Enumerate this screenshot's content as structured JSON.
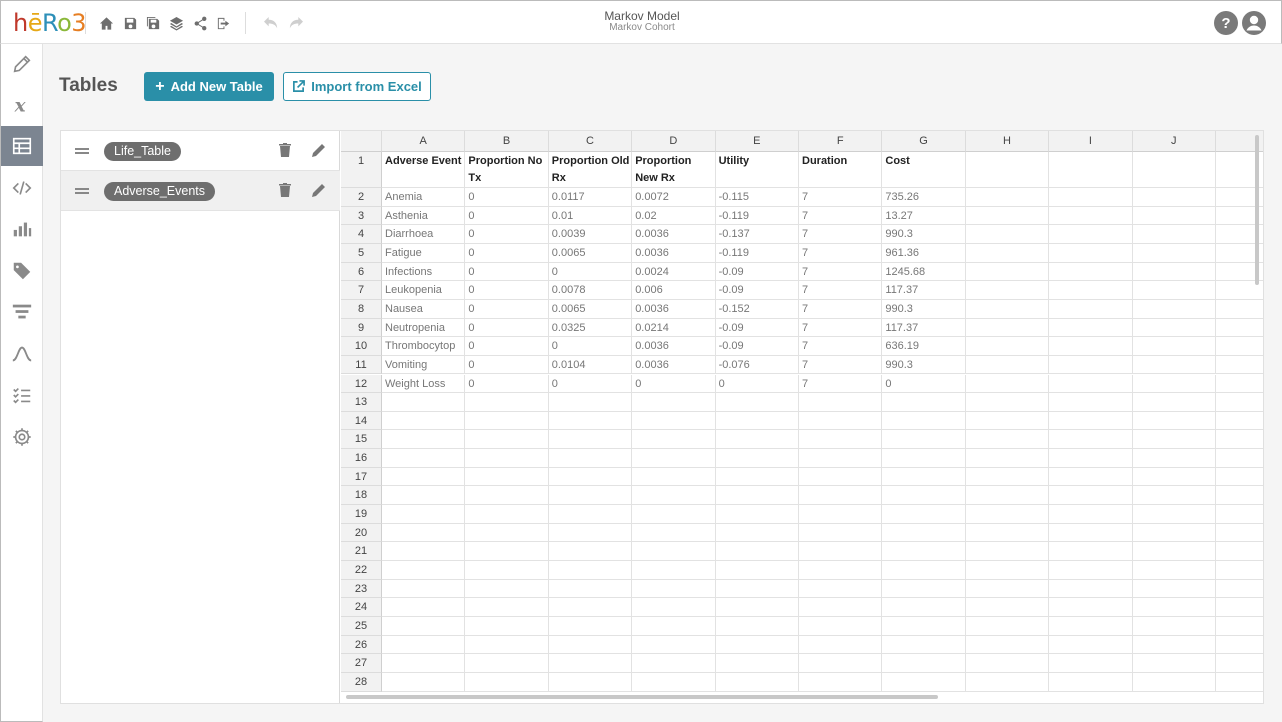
{
  "app": {
    "logo": [
      "h",
      "ē",
      "R",
      "o",
      "3"
    ],
    "title": "Markov Model",
    "subtitle": "Markov Cohort",
    "help_label": "?"
  },
  "toolbar": {
    "icons": [
      "home-icon",
      "save-icon",
      "save-as-icon",
      "layers-icon",
      "share-icon",
      "export-icon",
      "undo-icon",
      "redo-icon"
    ]
  },
  "sidebar": {
    "items": [
      "pencil-icon",
      "variable-x-icon",
      "table-icon",
      "code-icon",
      "bar-chart-icon",
      "tag-icon",
      "filter-icon",
      "curve-icon",
      "checklist-icon",
      "gear-icon"
    ],
    "active": "table-icon"
  },
  "page": {
    "title": "Tables",
    "add_label": "Add New Table",
    "import_label": "Import from Excel"
  },
  "tables": [
    {
      "name": "Life_Table",
      "selected": false
    },
    {
      "name": "Adverse_Events",
      "selected": true
    }
  ],
  "sheet": {
    "columns": [
      "A",
      "B",
      "C",
      "D",
      "E",
      "F",
      "G",
      "H",
      "I",
      "J",
      ""
    ],
    "header_row": [
      "Adverse Event",
      "Proportion No Tx",
      "Proportion Old Rx",
      "Proportion New Rx",
      "Utility",
      "Duration",
      "Cost"
    ],
    "rows": [
      [
        "Anemia",
        "0",
        "0.0117",
        "0.0072",
        "-0.115",
        "7",
        "735.26"
      ],
      [
        "Asthenia",
        "0",
        "0.01",
        "0.02",
        "-0.119",
        "7",
        "13.27"
      ],
      [
        "Diarrhoea",
        "0",
        "0.0039",
        "0.0036",
        "-0.137",
        "7",
        "990.3"
      ],
      [
        "Fatigue",
        "0",
        "0.0065",
        "0.0036",
        "-0.119",
        "7",
        "961.36"
      ],
      [
        "Infections",
        "0",
        "0",
        "0.0024",
        "-0.09",
        "7",
        "1245.68"
      ],
      [
        "Leukopenia",
        "0",
        "0.0078",
        "0.006",
        "-0.09",
        "7",
        "117.37"
      ],
      [
        "Nausea",
        "0",
        "0.0065",
        "0.0036",
        "-0.152",
        "7",
        "990.3"
      ],
      [
        "Neutropenia",
        "0",
        "0.0325",
        "0.0214",
        "-0.09",
        "7",
        "117.37"
      ],
      [
        "Thrombocytop",
        "0",
        "0",
        "0.0036",
        "-0.09",
        "7",
        "636.19"
      ],
      [
        "Vomiting",
        "0",
        "0.0104",
        "0.0036",
        "-0.076",
        "7",
        "990.3"
      ],
      [
        "Weight Loss",
        "0",
        "0",
        "0",
        "0",
        "7",
        "0"
      ]
    ],
    "row_numbers": [
      "1",
      "2",
      "3",
      "4",
      "5",
      "6",
      "7",
      "8",
      "9",
      "10",
      "11",
      "12",
      "13",
      "14",
      "15",
      "16",
      "17",
      "18",
      "19",
      "20",
      "21",
      "22",
      "23",
      "24",
      "25",
      "26",
      "27",
      "28"
    ]
  }
}
